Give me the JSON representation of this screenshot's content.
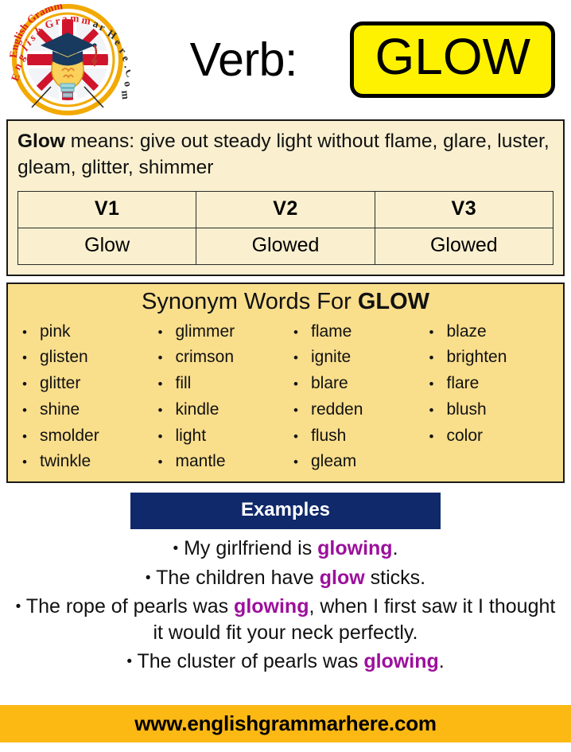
{
  "logo": {
    "alt_name": "english-grammar-here-logo",
    "ring_text": "English Grammar Here.Com",
    "ring_color": "#F2A900",
    "text_color_left": "#D91F26",
    "text_color_right": "#2B2B2B"
  },
  "header": {
    "verb_label": "Verb:",
    "title": "GLOW",
    "title_box_color": "#FFF200",
    "title_border_color": "#000000"
  },
  "definition": {
    "lead_word": "Glow",
    "rest": " means: give out steady light without flame, glare, luster, gleam, glitter, shimmer",
    "background": "#FAF0D0"
  },
  "verb_table": {
    "headers": [
      "V1",
      "V2",
      "V3"
    ],
    "values": [
      "Glow",
      "Glowed",
      "Glowed"
    ]
  },
  "synonyms": {
    "title_prefix": "Synonym Words For ",
    "title_word": "GLOW",
    "background": "#F9DE8C",
    "bullet": "•",
    "columns": [
      [
        "pink",
        "glisten",
        "glitter",
        "shine",
        "smolder",
        "twinkle"
      ],
      [
        "glimmer",
        "crimson",
        "fill",
        "kindle",
        "light",
        "mantle"
      ],
      [
        "flame",
        "ignite",
        "blare",
        "redden",
        "flush",
        "gleam"
      ],
      [
        "blaze",
        "brighten",
        "flare",
        "blush",
        "color"
      ]
    ]
  },
  "examples": {
    "heading": "Examples",
    "heading_bg": "#10296B",
    "highlight_color": "#9C109C",
    "bullet": "•",
    "items": [
      {
        "pre": "My girlfriend is ",
        "highlight": "glowing",
        "post": "."
      },
      {
        "pre": "The children have ",
        "highlight": "glow",
        "post": " sticks."
      },
      {
        "pre": "The rope of pearls was ",
        "highlight": "glowing",
        "post": ", when I first saw it I thought it would fit your neck perfectly."
      },
      {
        "pre": "The cluster of pearls was ",
        "highlight": "glowing",
        "post": "."
      }
    ]
  },
  "footer": {
    "url": "www.englishgrammarhere.com",
    "background": "#FCB813"
  }
}
